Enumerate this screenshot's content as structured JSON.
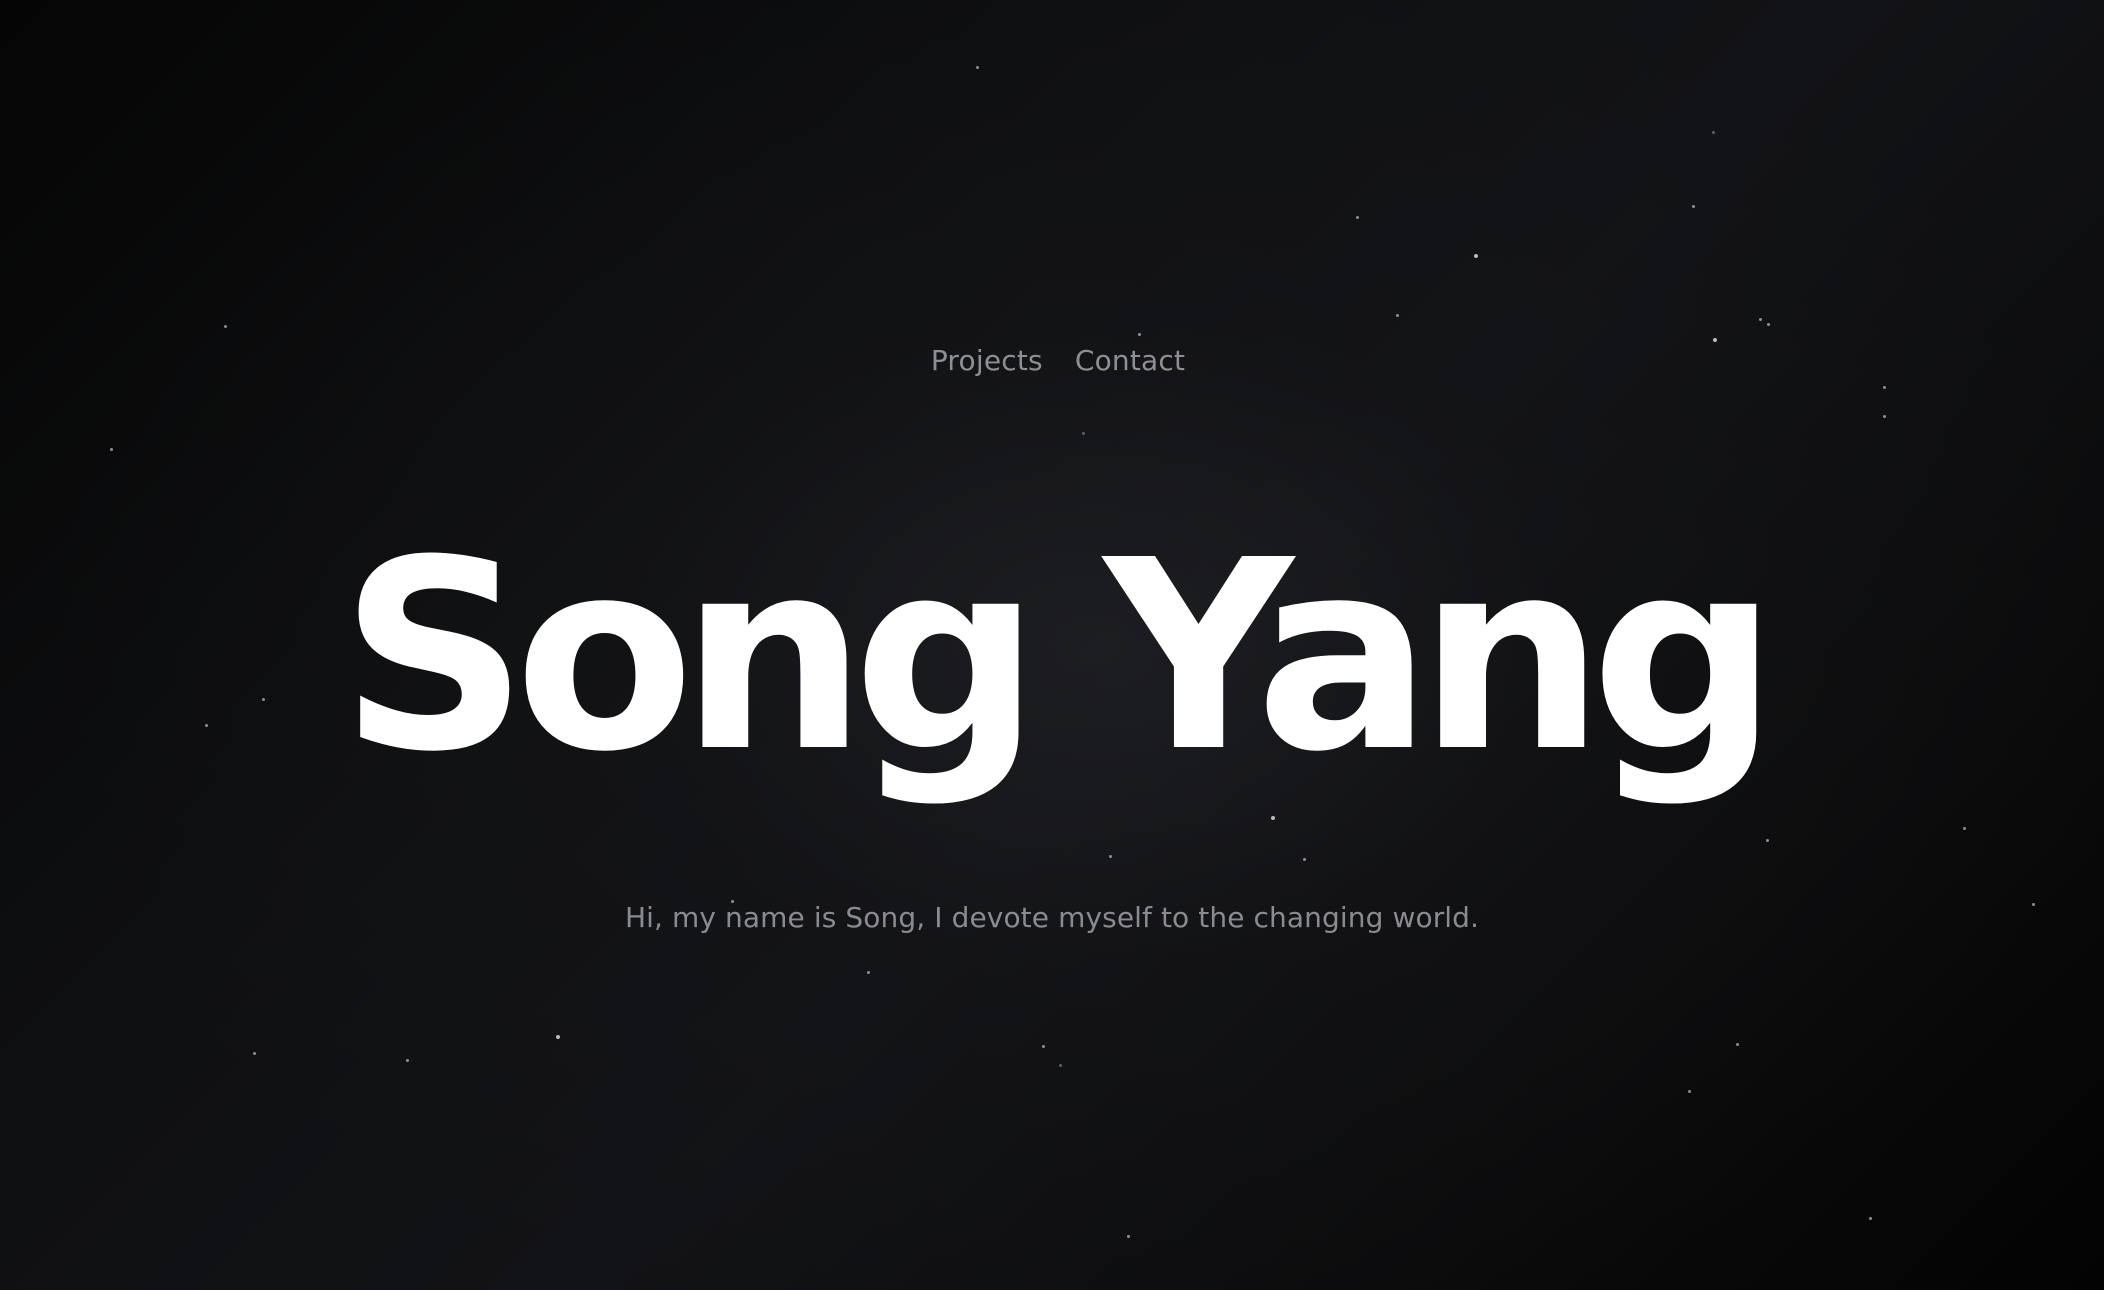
{
  "nav": {
    "items": [
      {
        "label": "Projects"
      },
      {
        "label": "Contact"
      }
    ]
  },
  "hero": {
    "title": "Song Yang",
    "tagline": "Hi, my name is Song, I devote myself to the changing world."
  },
  "colors": {
    "background": "#0a0a0b",
    "title": "#ffffff",
    "muted_text": "#8e8f94",
    "star": "#8c8f94"
  }
}
